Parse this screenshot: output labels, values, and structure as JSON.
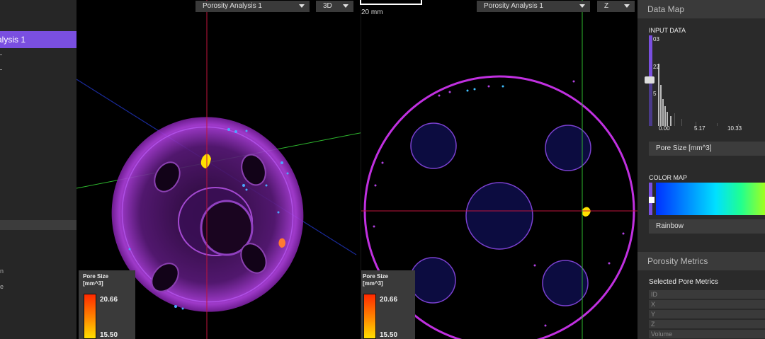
{
  "left_panel": {
    "selected_item": "alysis 1",
    "fragments": [
      "n",
      "e"
    ]
  },
  "viewport_left": {
    "analysis_dropdown": "Porosity Analysis 1",
    "mode_dropdown": "3D",
    "scale_label": "20 mm",
    "legend": {
      "title_line1": "Pore Size",
      "title_line2": "[mm^3]",
      "max": "20.66",
      "min": "15.50"
    }
  },
  "viewport_right": {
    "analysis_dropdown": "Porosity Analysis 1",
    "axis_dropdown": "Z",
    "legend": {
      "title_line1": "Pore Size",
      "title_line2": "[mm^3]",
      "max": "20.66",
      "min": "15.50"
    }
  },
  "data_map": {
    "header": "Data Map",
    "input_label": "INPUT DATA",
    "y_ticks": [
      "03",
      "22",
      "5"
    ],
    "x_ticks": [
      "0.00",
      "5.17",
      "10.33"
    ],
    "field": "Pore Size [mm^3]",
    "color_map_label": "COLOR MAP",
    "color_map_value": "Rainbow"
  },
  "porosity_metrics": {
    "header": "Porosity Metrics",
    "subheader": "Selected Pore Metrics",
    "rows": [
      "ID",
      "X",
      "Y",
      "Z",
      "Volume"
    ]
  },
  "colors": {
    "accent": "#7a4fe0",
    "panel": "#2a2a2a",
    "crosshair_red": "#c0143c",
    "crosshair_green": "#2eb82e"
  }
}
